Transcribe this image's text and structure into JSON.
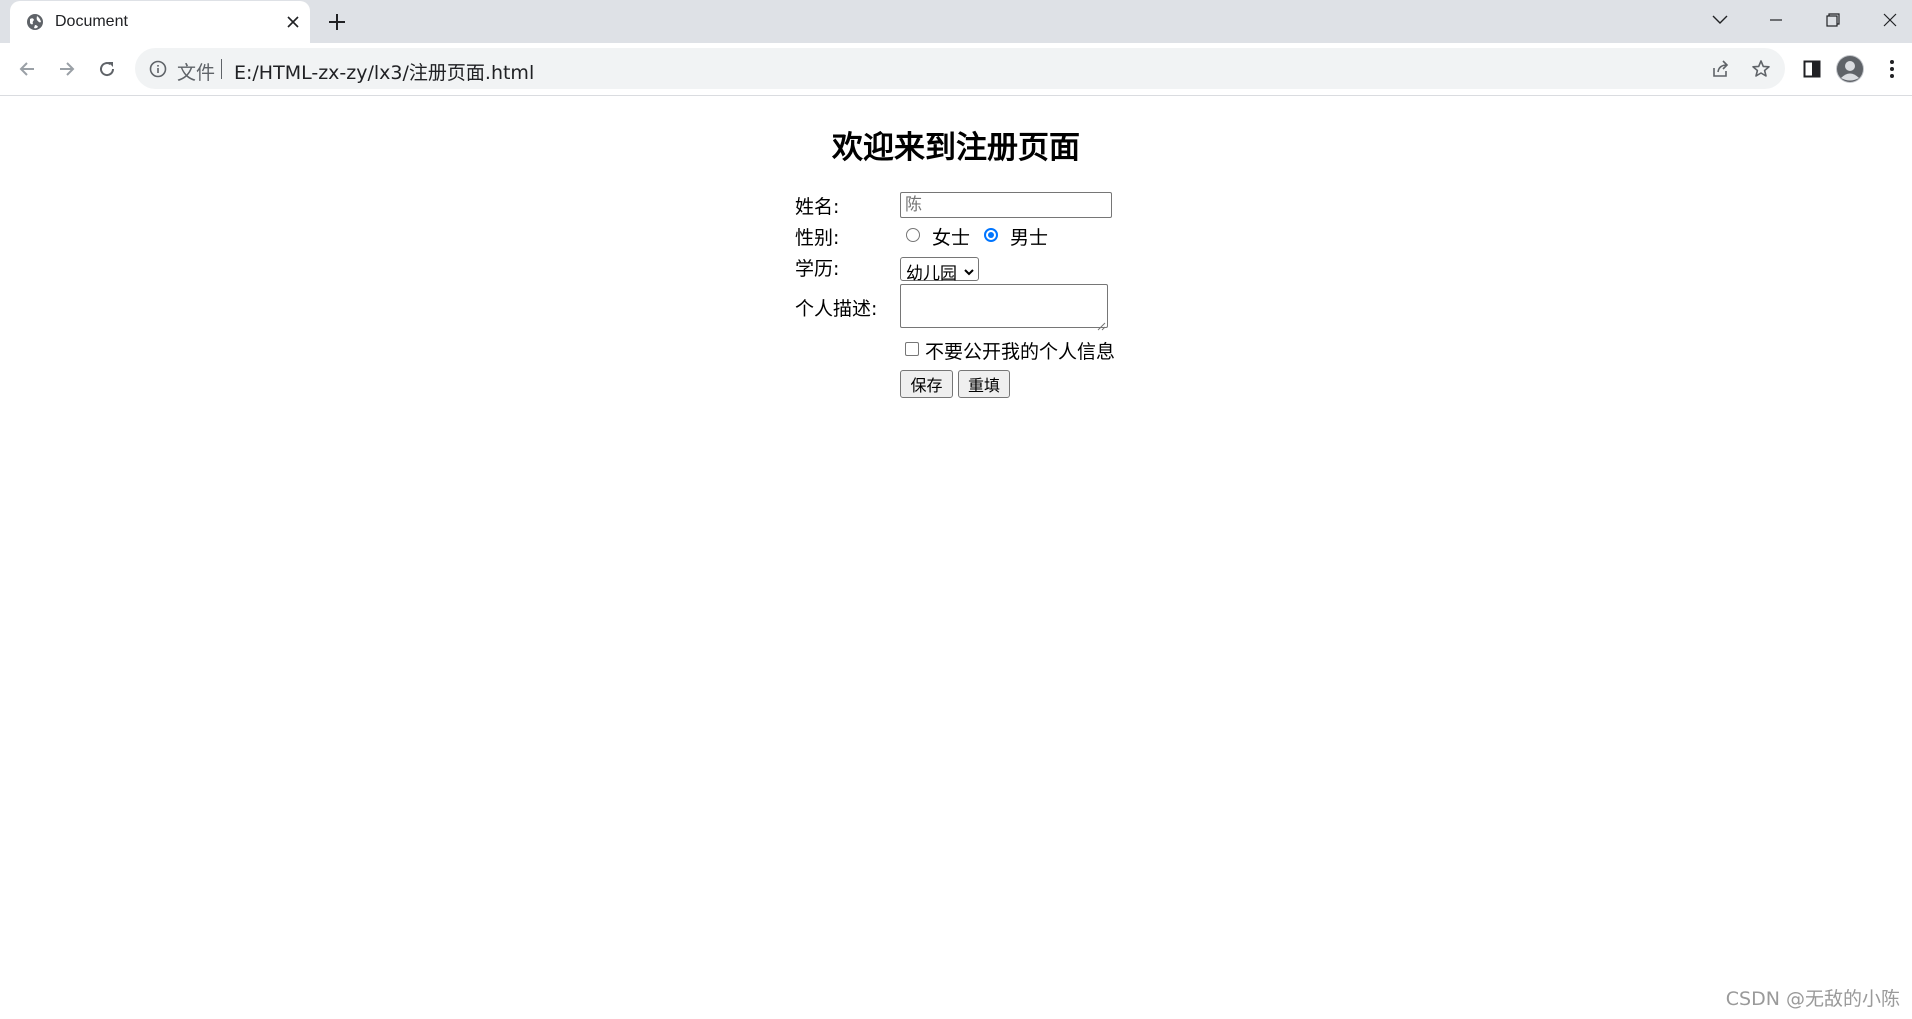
{
  "browser": {
    "tab": {
      "title": "Document"
    },
    "address_bar": {
      "chip_label": "文件",
      "url": "E:/HTML-zx-zy/lx3/注册页面.html"
    },
    "icons": {
      "favicon": "globe-icon",
      "close": "close-icon",
      "new_tab": "plus-icon",
      "tab_search": "chevron-down-icon",
      "minimize": "minimize-icon",
      "restore": "restore-icon",
      "window_close": "close-icon",
      "back": "back-arrow-icon",
      "forward": "forward-arrow-icon",
      "reload": "reload-icon",
      "info": "info-icon",
      "share": "share-icon",
      "bookmark": "star-icon",
      "side_panel": "side-panel-icon",
      "profile": "person-icon",
      "menu": "kebab-menu-icon"
    }
  },
  "page": {
    "heading": "欢迎来到注册页面",
    "form": {
      "name": {
        "label": "姓名:",
        "placeholder": "陈",
        "value": ""
      },
      "gender": {
        "label": "性别:",
        "options": [
          {
            "label": "女士",
            "checked": false
          },
          {
            "label": "男士",
            "checked": true
          }
        ]
      },
      "education": {
        "label": "学历:",
        "selected": "幼儿园"
      },
      "description": {
        "label": "个人描述:",
        "value": ""
      },
      "privacy": {
        "label": "不要公开我的个人信息",
        "checked": false
      },
      "buttons": {
        "save": "保存",
        "reset": "重填"
      }
    },
    "watermark": "CSDN @无敌的小陈"
  },
  "colors": {
    "tabstrip_bg": "#dee1e6",
    "omnibox_bg": "#f1f3f4",
    "radio_accent": "#0075ff",
    "button_bg": "#efefef"
  }
}
